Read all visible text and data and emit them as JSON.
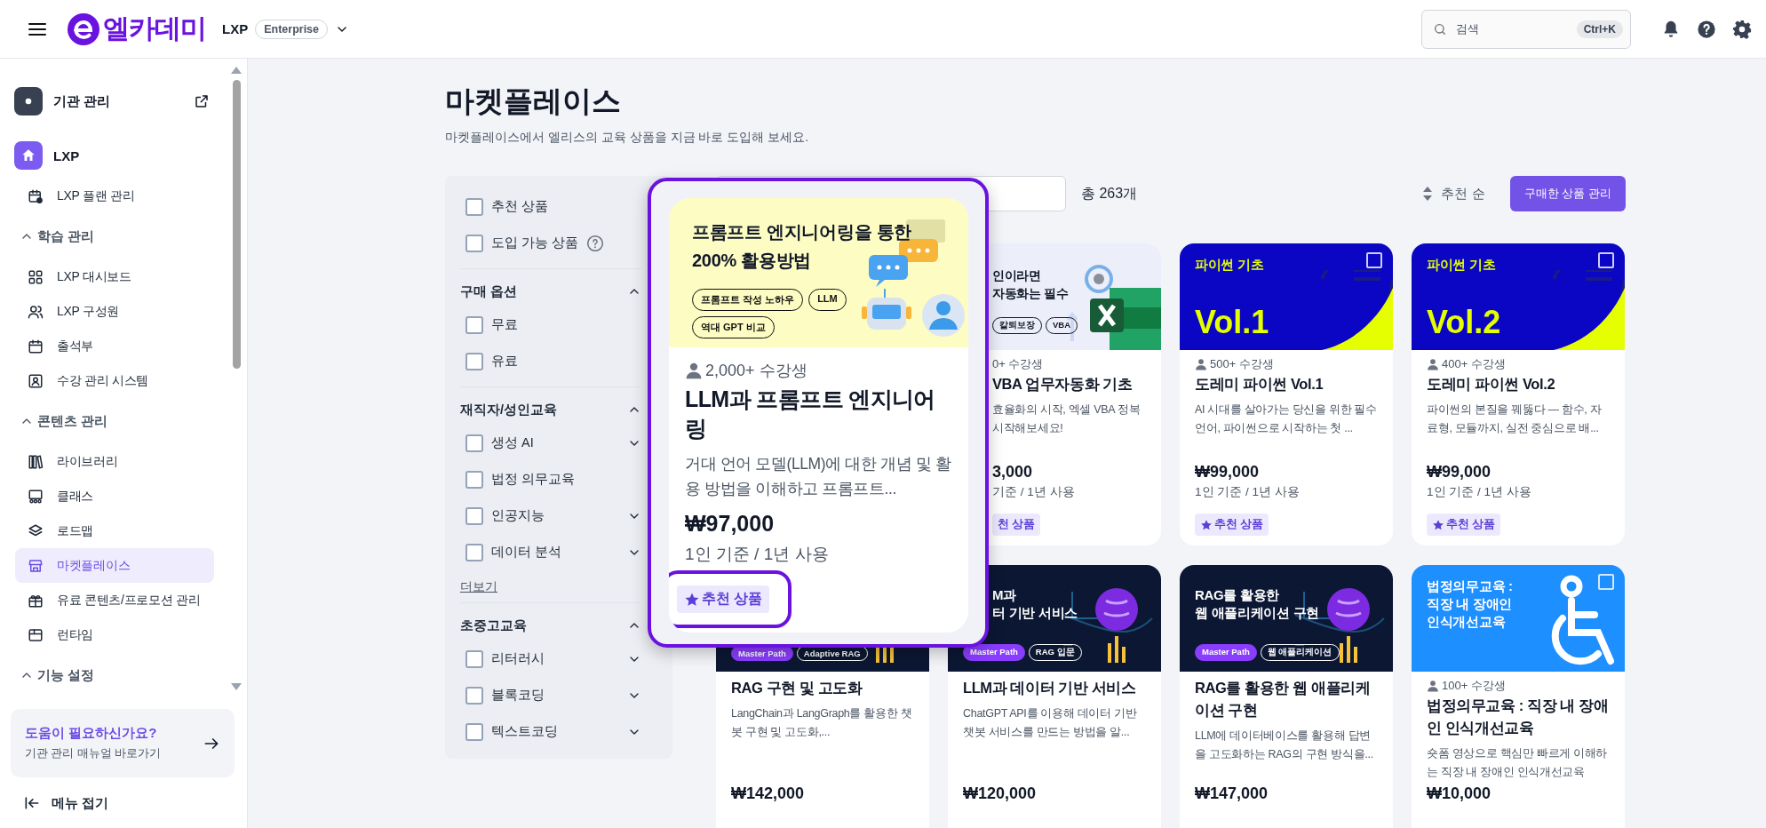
{
  "topbar": {
    "logo": "엘카데미",
    "workspace": "LXP",
    "plan": "Enterprise",
    "search": {
      "placeholder": "검색",
      "shortcut": "Ctrl+K"
    }
  },
  "sidebar": {
    "items": [
      {
        "kind": "org",
        "label": "기관 관리"
      },
      {
        "kind": "home",
        "label": "LXP",
        "children": [
          {
            "label": "LXP 플랜 관리",
            "selected": false
          }
        ]
      },
      {
        "kind": "section",
        "label": "학습 관리",
        "expanded": true,
        "children": [
          {
            "label": "LXP 대시보드",
            "selected": false
          },
          {
            "label": "LXP 구성원",
            "selected": false
          },
          {
            "label": "출석부",
            "selected": false
          },
          {
            "label": "수강 관리 시스템",
            "selected": false
          }
        ]
      },
      {
        "kind": "section",
        "label": "콘텐츠 관리",
        "expanded": true,
        "children": [
          {
            "label": "라이브러리",
            "selected": false
          },
          {
            "label": "클래스",
            "selected": false
          },
          {
            "label": "로드맵",
            "selected": false
          },
          {
            "label": "마켓플레이스",
            "selected": true
          },
          {
            "label": "유료 콘텐츠/프로모션 관리",
            "selected": false
          },
          {
            "label": "런타임",
            "selected": false
          }
        ]
      },
      {
        "kind": "section",
        "label": "기능 설정",
        "expanded": true
      }
    ],
    "help": {
      "title": "도움이 필요하신가요?",
      "subtitle": "기관 관리 매뉴얼 바로가기"
    },
    "collapse": "메뉴 접기"
  },
  "page": {
    "title": "마켓플레이스",
    "subtitle": "마켓플레이스에서 엘리스의 교육 상품을 지금 바로 도입해 보세요."
  },
  "filters": {
    "quick": [
      {
        "label": "추천 상품",
        "checked": false,
        "help": false
      },
      {
        "label": "도입 가능 상품",
        "checked": false,
        "help": true
      }
    ],
    "sections": [
      {
        "title": "구매 옵션",
        "expanded": true,
        "options": [
          {
            "label": "무료",
            "checked": false,
            "expandable": false
          },
          {
            "label": "유료",
            "checked": false,
            "expandable": false
          }
        ]
      },
      {
        "title": "재직자/성인교육",
        "expanded": true,
        "options": [
          {
            "label": "생성 AI",
            "checked": false,
            "expandable": true
          },
          {
            "label": "법정 의무교육",
            "checked": false,
            "expandable": false
          },
          {
            "label": "인공지능",
            "checked": false,
            "expandable": true
          },
          {
            "label": "데이터 분석",
            "checked": false,
            "expandable": true
          }
        ],
        "more": "더보기"
      },
      {
        "title": "초중고교육",
        "expanded": true,
        "options": [
          {
            "label": "리터러시",
            "checked": false,
            "expandable": true
          },
          {
            "label": "블록코딩",
            "checked": false,
            "expandable": true
          },
          {
            "label": "텍스트코딩",
            "checked": false,
            "expandable": true
          }
        ]
      }
    ]
  },
  "toolbar": {
    "total": "총 263개",
    "sort": "추천 순",
    "purchased_button": "구매한 상품 관리"
  },
  "preview": {
    "kind": "yellow",
    "banner": {
      "heading_lines": [
        "프롬프트 엔지니어링을 통한",
        "200% 활용방법"
      ],
      "tags": [
        "프롬프트 작성 노하우",
        "LLM",
        "역대 GPT 비교"
      ]
    },
    "students": "2,000+ 수강생",
    "title": "LLM과 프롬프트 엔지니어링",
    "desc": "거대 언어 모델(LLM)에 대한 개념 및 활용 방법을 이해하고 프롬프트...",
    "price": "₩97,000",
    "per": "1인 기준 / 1년 사용",
    "badge": "추천 상품"
  },
  "products": [
    {
      "kind": "excel",
      "banner": {
        "heading_lines": [
          "인이라면",
          "자동화는 필수"
        ],
        "tags": [
          "칼퇴보장",
          "VBA"
        ]
      },
      "students": "0+ 수강생",
      "title": "VBA 업무자동화 기초",
      "desc": "효율화의 시작, 엑셀 VBA 정복\n시작해보세요!",
      "price": "3,000",
      "per": "기준 / 1년 사용",
      "badge": "천 상품"
    },
    {
      "kind": "python",
      "banner": {
        "heading_lines": [
          "파이썬 기초"
        ],
        "subtitle": "Vol.1",
        "checkbox": {
          "checked": false
        }
      },
      "students": "500+ 수강생",
      "title": "도레미 파이썬 Vol.1",
      "desc": "AI 시대를 살아가는 당신을 위한 필수 언어, 파이썬으로 시작하는 첫 ...",
      "price": "₩99,000",
      "per": "1인 기준 / 1년 사용",
      "badge": "추천 상품"
    },
    {
      "kind": "python",
      "banner": {
        "heading_lines": [
          "파이썬 기초"
        ],
        "subtitle": "Vol.2",
        "checkbox": {
          "checked": false
        }
      },
      "students": "400+ 수강생",
      "title": "도레미 파이썬 Vol.2",
      "desc": "파이썬의 본질을 꿰뚫다 — 함수, 자료형, 모듈까지, 실전 중심으로 배...",
      "price": "₩99,000",
      "per": "1인 기준 / 1년 사용",
      "badge": "추천 상품"
    },
    {
      "kind": "navy",
      "banner": {
        "tags": [
          "Master Path",
          "Adaptive RAG"
        ]
      },
      "title": "RAG 구현 및 고도화",
      "desc": "LangChain과 LangGraph를 활용한 챗봇 구현 및 고도화,...",
      "price": "₩142,000"
    },
    {
      "kind": "navy",
      "banner": {
        "heading_lines": [
          "M과",
          "터 기반 서비스"
        ],
        "tags": [
          "Master Path",
          "RAG 입문"
        ]
      },
      "title": "LLM과 데이터 기반 서비스",
      "desc": "ChatGPT API를 이용해 데이터 기반 챗봇 서비스를 만드는 방법을 알...",
      "price": "₩120,000"
    },
    {
      "kind": "navy",
      "banner": {
        "heading_lines": [
          "RAG를 활용한",
          "웹 애플리케이션 구현"
        ],
        "tags": [
          "Master Path",
          "웹 애플리케이션"
        ]
      },
      "title": "RAG를 활용한 웹 애플리케이션 구현",
      "desc": "LLM에 데이터베이스를 활용해 답변을 고도화하는 RAG의 구현 방식을...",
      "price": "₩147,000"
    },
    {
      "kind": "blue",
      "banner": {
        "heading_lines": [
          "법정의무교육 :",
          "직장 내 장애인",
          "인식개선교육"
        ],
        "checkbox": {
          "checked": false
        }
      },
      "students": "100+ 수강생",
      "title": "법정의무교육 : 직장 내 장애인 인식개선교육",
      "desc": "숏폼 영상으로 핵심만 빠르게 이해하는 직장 내 장애인 인식개선교육",
      "price": "₩10,000"
    }
  ]
}
